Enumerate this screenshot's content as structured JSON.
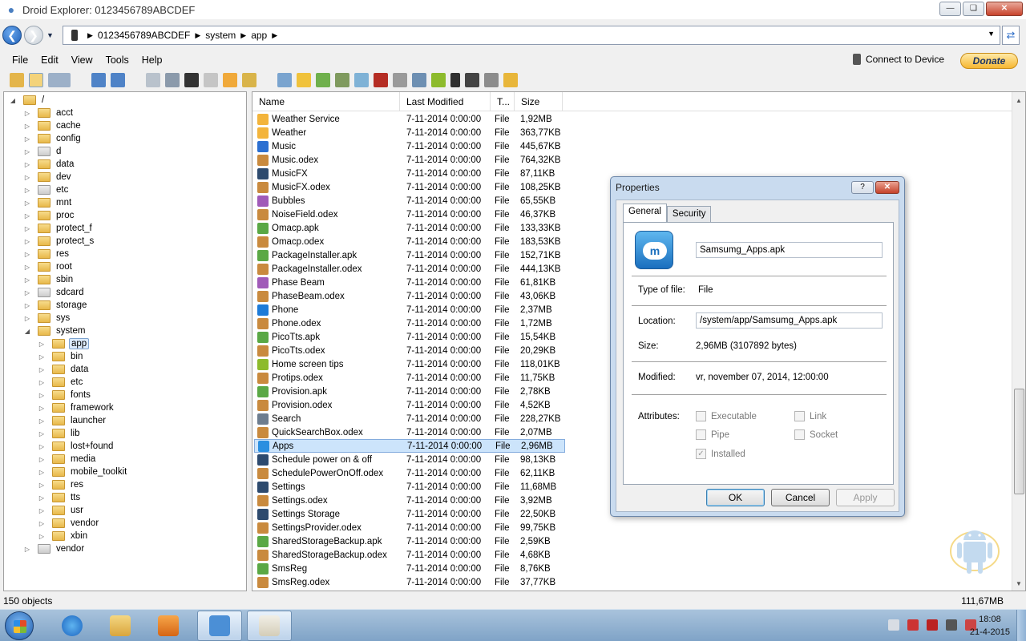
{
  "window": {
    "title": "Droid Explorer: 0123456789ABCDEF"
  },
  "address": {
    "crumbs": [
      "0123456789ABCDEF",
      "system",
      "app"
    ]
  },
  "menu": [
    "File",
    "Edit",
    "View",
    "Tools",
    "Help"
  ],
  "connect_label": "Connect to Device",
  "donate_label": "Donate",
  "tree": [
    {
      "label": "/",
      "level": 0,
      "expanded": true
    },
    {
      "label": "acct",
      "level": 1
    },
    {
      "label": "cache",
      "level": 1
    },
    {
      "label": "config",
      "level": 1
    },
    {
      "label": "d",
      "level": 1,
      "gray": true
    },
    {
      "label": "data",
      "level": 1
    },
    {
      "label": "dev",
      "level": 1
    },
    {
      "label": "etc",
      "level": 1,
      "gray": true
    },
    {
      "label": "mnt",
      "level": 1
    },
    {
      "label": "proc",
      "level": 1
    },
    {
      "label": "protect_f",
      "level": 1
    },
    {
      "label": "protect_s",
      "level": 1
    },
    {
      "label": "res",
      "level": 1
    },
    {
      "label": "root",
      "level": 1
    },
    {
      "label": "sbin",
      "level": 1
    },
    {
      "label": "sdcard",
      "level": 1,
      "gray": true
    },
    {
      "label": "storage",
      "level": 1
    },
    {
      "label": "sys",
      "level": 1
    },
    {
      "label": "system",
      "level": 1,
      "expanded": true
    },
    {
      "label": "app",
      "level": 2,
      "selected": true
    },
    {
      "label": "bin",
      "level": 2
    },
    {
      "label": "data",
      "level": 2
    },
    {
      "label": "etc",
      "level": 2
    },
    {
      "label": "fonts",
      "level": 2
    },
    {
      "label": "framework",
      "level": 2
    },
    {
      "label": "launcher",
      "level": 2
    },
    {
      "label": "lib",
      "level": 2
    },
    {
      "label": "lost+found",
      "level": 2
    },
    {
      "label": "media",
      "level": 2
    },
    {
      "label": "mobile_toolkit",
      "level": 2
    },
    {
      "label": "res",
      "level": 2
    },
    {
      "label": "tts",
      "level": 2
    },
    {
      "label": "usr",
      "level": 2
    },
    {
      "label": "vendor",
      "level": 2
    },
    {
      "label": "xbin",
      "level": 2
    },
    {
      "label": "vendor",
      "level": 1,
      "gray": true
    }
  ],
  "columns": [
    "Name",
    "Last Modified",
    "T...",
    "Size"
  ],
  "files": [
    {
      "name": "Weather Service",
      "modified": "7-11-2014 0:00:00",
      "type": "File",
      "size": "1,92MB",
      "icon": "weather-icon"
    },
    {
      "name": "Weather",
      "modified": "7-11-2014 0:00:00",
      "type": "File",
      "size": "363,77KB",
      "icon": "weather-icon"
    },
    {
      "name": "Music",
      "modified": "7-11-2014 0:00:00",
      "type": "File",
      "size": "445,67KB",
      "icon": "music-icon"
    },
    {
      "name": "Music.odex",
      "modified": "7-11-2014 0:00:00",
      "type": "File",
      "size": "764,32KB",
      "icon": "package-icon"
    },
    {
      "name": "MusicFX",
      "modified": "7-11-2014 0:00:00",
      "type": "File",
      "size": "87,11KB",
      "icon": "app-icon"
    },
    {
      "name": "MusicFX.odex",
      "modified": "7-11-2014 0:00:00",
      "type": "File",
      "size": "108,25KB",
      "icon": "package-icon"
    },
    {
      "name": "Bubbles",
      "modified": "7-11-2014 0:00:00",
      "type": "File",
      "size": "65,55KB",
      "icon": "image-icon"
    },
    {
      "name": "NoiseField.odex",
      "modified": "7-11-2014 0:00:00",
      "type": "File",
      "size": "46,37KB",
      "icon": "package-icon"
    },
    {
      "name": "Omacp.apk",
      "modified": "7-11-2014 0:00:00",
      "type": "File",
      "size": "133,33KB",
      "icon": "apk-icon"
    },
    {
      "name": "Omacp.odex",
      "modified": "7-11-2014 0:00:00",
      "type": "File",
      "size": "183,53KB",
      "icon": "package-icon"
    },
    {
      "name": "PackageInstaller.apk",
      "modified": "7-11-2014 0:00:00",
      "type": "File",
      "size": "152,71KB",
      "icon": "apk-icon"
    },
    {
      "name": "PackageInstaller.odex",
      "modified": "7-11-2014 0:00:00",
      "type": "File",
      "size": "444,13KB",
      "icon": "package-icon"
    },
    {
      "name": "Phase Beam",
      "modified": "7-11-2014 0:00:00",
      "type": "File",
      "size": "61,81KB",
      "icon": "image-icon"
    },
    {
      "name": "PhaseBeam.odex",
      "modified": "7-11-2014 0:00:00",
      "type": "File",
      "size": "43,06KB",
      "icon": "package-icon"
    },
    {
      "name": "Phone",
      "modified": "7-11-2014 0:00:00",
      "type": "File",
      "size": "2,37MB",
      "icon": "phone-icon"
    },
    {
      "name": "Phone.odex",
      "modified": "7-11-2014 0:00:00",
      "type": "File",
      "size": "1,72MB",
      "icon": "package-icon"
    },
    {
      "name": "PicoTts.apk",
      "modified": "7-11-2014 0:00:00",
      "type": "File",
      "size": "15,54KB",
      "icon": "apk-icon"
    },
    {
      "name": "PicoTts.odex",
      "modified": "7-11-2014 0:00:00",
      "type": "File",
      "size": "20,29KB",
      "icon": "package-icon"
    },
    {
      "name": "Home screen tips",
      "modified": "7-11-2014 0:00:00",
      "type": "File",
      "size": "118,01KB",
      "icon": "android-icon"
    },
    {
      "name": "Protips.odex",
      "modified": "7-11-2014 0:00:00",
      "type": "File",
      "size": "11,75KB",
      "icon": "package-icon"
    },
    {
      "name": "Provision.apk",
      "modified": "7-11-2014 0:00:00",
      "type": "File",
      "size": "2,78KB",
      "icon": "apk-icon"
    },
    {
      "name": "Provision.odex",
      "modified": "7-11-2014 0:00:00",
      "type": "File",
      "size": "4,52KB",
      "icon": "package-icon"
    },
    {
      "name": "Search",
      "modified": "7-11-2014 0:00:00",
      "type": "File",
      "size": "228,27KB",
      "icon": "search-icon"
    },
    {
      "name": "QuickSearchBox.odex",
      "modified": "7-11-2014 0:00:00",
      "type": "File",
      "size": "2,07MB",
      "icon": "package-icon"
    },
    {
      "name": "Apps",
      "modified": "7-11-2014 0:00:00",
      "type": "File",
      "size": "2,96MB",
      "icon": "apps-icon",
      "selected": true
    },
    {
      "name": "Schedule power on & off",
      "modified": "7-11-2014 0:00:00",
      "type": "File",
      "size": "98,13KB",
      "icon": "app-icon"
    },
    {
      "name": "SchedulePowerOnOff.odex",
      "modified": "7-11-2014 0:00:00",
      "type": "File",
      "size": "62,11KB",
      "icon": "package-icon"
    },
    {
      "name": "Settings",
      "modified": "7-11-2014 0:00:00",
      "type": "File",
      "size": "11,68MB",
      "icon": "app-icon"
    },
    {
      "name": "Settings.odex",
      "modified": "7-11-2014 0:00:00",
      "type": "File",
      "size": "3,92MB",
      "icon": "package-icon"
    },
    {
      "name": "Settings Storage",
      "modified": "7-11-2014 0:00:00",
      "type": "File",
      "size": "22,50KB",
      "icon": "app-icon"
    },
    {
      "name": "SettingsProvider.odex",
      "modified": "7-11-2014 0:00:00",
      "type": "File",
      "size": "99,75KB",
      "icon": "package-icon"
    },
    {
      "name": "SharedStorageBackup.apk",
      "modified": "7-11-2014 0:00:00",
      "type": "File",
      "size": "2,59KB",
      "icon": "apk-icon"
    },
    {
      "name": "SharedStorageBackup.odex",
      "modified": "7-11-2014 0:00:00",
      "type": "File",
      "size": "4,68KB",
      "icon": "package-icon"
    },
    {
      "name": "SmsReg",
      "modified": "7-11-2014 0:00:00",
      "type": "File",
      "size": "8,76KB",
      "icon": "apk-icon"
    },
    {
      "name": "SmsReg.odex",
      "modified": "7-11-2014 0:00:00",
      "type": "File",
      "size": "37,77KB",
      "icon": "package-icon"
    }
  ],
  "status": {
    "objects": "150 objects",
    "total": "111,67MB"
  },
  "clock": {
    "time": "18:08",
    "date": "21-4-2015"
  },
  "dialog": {
    "title": "Properties",
    "help": "?",
    "tabs": [
      "General",
      "Security"
    ],
    "filename": "Samsumg_Apps.apk",
    "type_label": "Type of file:",
    "type_value": "File",
    "location_label": "Location:",
    "location_value": "/system/app/Samsumg_Apps.apk",
    "size_label": "Size:",
    "size_value": "2,96MB (3107892 bytes)",
    "modified_label": "Modified:",
    "modified_value": "vr, november 07, 2014, 12:00:00",
    "attributes_label": "Attributes:",
    "attributes": [
      {
        "label": "Executable",
        "checked": false
      },
      {
        "label": "Link",
        "checked": false
      },
      {
        "label": "Pipe",
        "checked": false
      },
      {
        "label": "Socket",
        "checked": false
      },
      {
        "label": "Installed",
        "checked": true
      }
    ],
    "ok": "OK",
    "cancel": "Cancel",
    "apply": "Apply"
  },
  "icon_colors": {
    "weather-icon": "#f3b43b",
    "music-icon": "#2b6fd1",
    "package-icon": "#c98a3e",
    "app-icon": "#2d4a6e",
    "image-icon": "#a05ab8",
    "apk-icon": "#5aa845",
    "phone-icon": "#1d7bd8",
    "android-icon": "#8dbb2c",
    "search-icon": "#6d7d8f",
    "apps-icon": "#2a8fe0"
  }
}
